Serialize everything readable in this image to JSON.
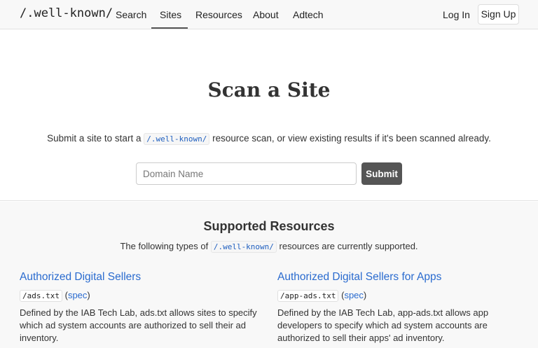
{
  "nav": {
    "brand": "/.well-known/",
    "links": [
      "Search",
      "Sites",
      "Resources",
      "About",
      "Adtech"
    ],
    "active": "Sites",
    "login": "Log In",
    "signup": "Sign Up"
  },
  "hero": {
    "title": "Scan a Site",
    "desc_before": "Submit a site to start a",
    "desc_code": "/.well-known/",
    "desc_after": "resource scan, or view existing results if it's been scanned already.",
    "input_placeholder": "Domain Name",
    "input_value": "",
    "submit_label": "Submit"
  },
  "resources": {
    "title": "Supported Resources",
    "desc_before": "The following types of",
    "desc_code": "/.well-known/",
    "desc_after": "resources are currently supported.",
    "cards": [
      {
        "title": "Authorized Digital Sellers",
        "file": "/ads.txt",
        "spec_label": "spec",
        "description": "Defined by the IAB Tech Lab, ads.txt allows sites to specify which ad system accounts are authorized to sell their ad inventory."
      },
      {
        "title": "Authorized Digital Sellers for Apps",
        "file": "/app-ads.txt",
        "spec_label": "spec",
        "description": "Defined by the IAB Tech Lab, app-ads.txt allows app developers to specify which ad system accounts are authorized to sell their apps' ad inventory."
      }
    ]
  },
  "colors": {
    "link_blue": "#2a6bcf",
    "submit_bg": "#555555",
    "section_bg": "#f8f8f8"
  }
}
